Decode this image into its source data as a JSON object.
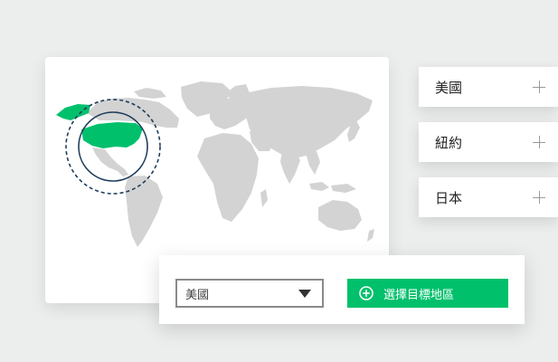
{
  "colors": {
    "accent": "#00c06c",
    "highlight_ring": "#1f3e5c",
    "land": "#d3d3d3"
  },
  "map": {
    "highlighted_region": "美國"
  },
  "region_list": {
    "items": [
      {
        "label": "美國",
        "icon": "plus-icon"
      },
      {
        "label": "紐約",
        "icon": "plus-icon"
      },
      {
        "label": "日本",
        "icon": "plus-icon"
      }
    ]
  },
  "selector": {
    "selected_value": "美國",
    "dropdown_icon": "caret-down-icon",
    "button_label": "選擇目標地區",
    "button_icon": "circle-plus-icon"
  }
}
